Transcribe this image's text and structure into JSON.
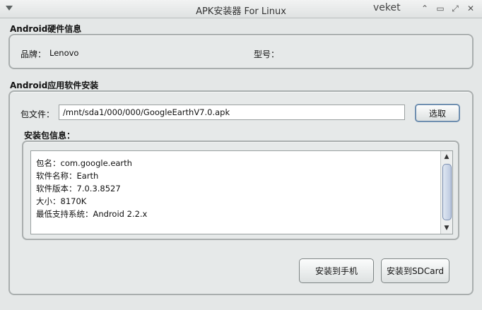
{
  "window": {
    "title": "APK安装器 For Linux",
    "brand": "veket",
    "controls": {
      "minimize": "⌃",
      "restore": "▭",
      "maximize": "⤢",
      "close": "✕"
    }
  },
  "hardware": {
    "section_title": "Android硬件信息",
    "brand_label": "品牌：",
    "brand_value": "Lenovo",
    "model_label": "型号：",
    "model_value": ""
  },
  "install": {
    "section_title": "Android应用软件安装",
    "package_file_label": "包文件：",
    "package_path": "/mnt/sda1/000/000/GoogleEarthV7.0.apk",
    "browse_button": "选取",
    "info_title": "安装包信息：",
    "info_lines": [
      "包名：com.google.earth",
      "软件名称：Earth",
      "软件版本：7.0.3.8527",
      "大小：8170K",
      "最低支持系统：Android 2.2.x"
    ],
    "install_phone_button": "安装到手机",
    "install_sdcard_button": "安装到SDCard"
  }
}
